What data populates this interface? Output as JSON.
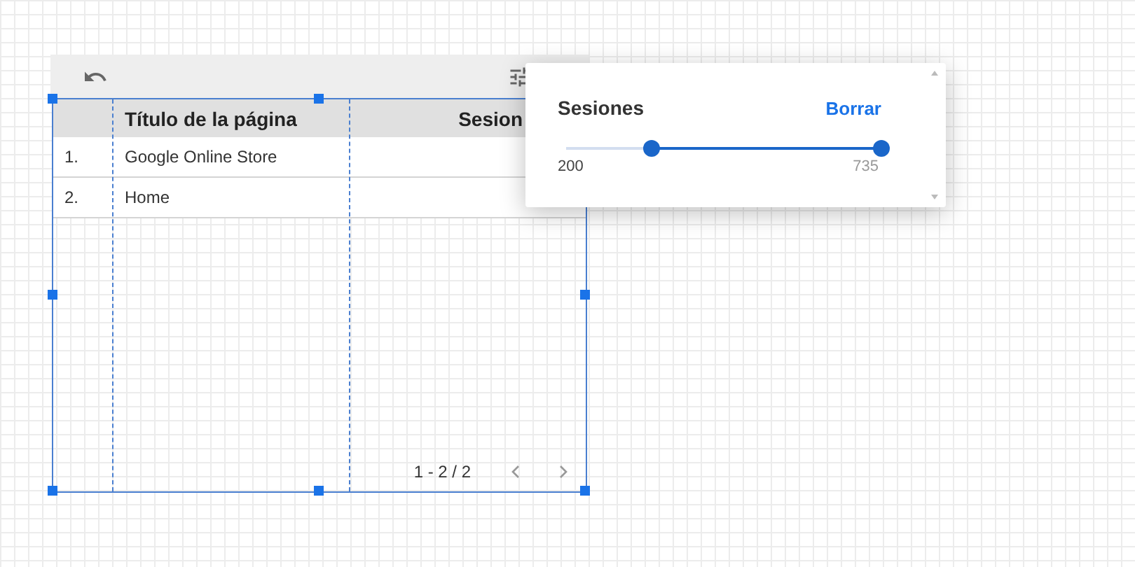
{
  "table": {
    "columns": [
      {
        "label": "Título de la página"
      },
      {
        "label": "Sesion"
      }
    ],
    "rows": [
      {
        "index": "1.",
        "title": "Google Online Store"
      },
      {
        "index": "2.",
        "title": "Home"
      }
    ],
    "pagination": "1 - 2 / 2"
  },
  "filter_popup": {
    "title": "Sesiones",
    "clear": "Borrar",
    "slider": {
      "start": {
        "level": 0.27
      },
      "end": {
        "level": 1
      }
    },
    "min": "200",
    "max": "735"
  }
}
